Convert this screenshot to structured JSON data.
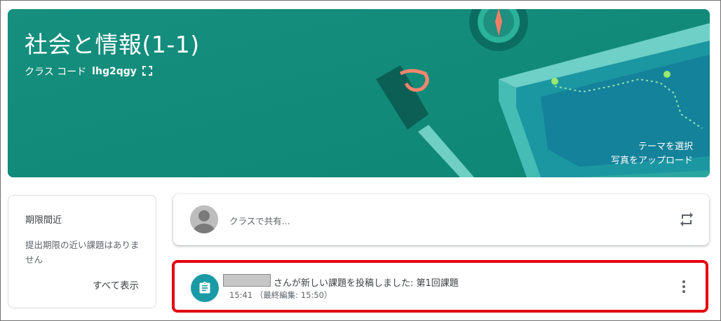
{
  "banner": {
    "class_title": "社会と情報(1-1)",
    "class_code_label": "クラス コード",
    "class_code": "lhg2qgy",
    "theme_link": "テーマを選択",
    "upload_link": "写真をアップロード",
    "bg_color": "#148c7c"
  },
  "upcoming": {
    "title": "期限間近",
    "empty_text": "提出期限の近い課題はありません",
    "view_all": "すべて表示"
  },
  "share": {
    "placeholder": "クラスで共有...",
    "avatar_icon": "person-icon",
    "repost_icon": "repost-icon"
  },
  "stream": {
    "items": [
      {
        "author": "",
        "title": "さんが新しい課題を投稿しました: 第1回課題",
        "time": "15:41 （最終編集: 15:50）",
        "icon": "assignment-icon",
        "icon_color": "#1a9aa5"
      }
    ]
  },
  "colors": {
    "highlight": "#e3000f",
    "accent": "#1a9aa5"
  }
}
